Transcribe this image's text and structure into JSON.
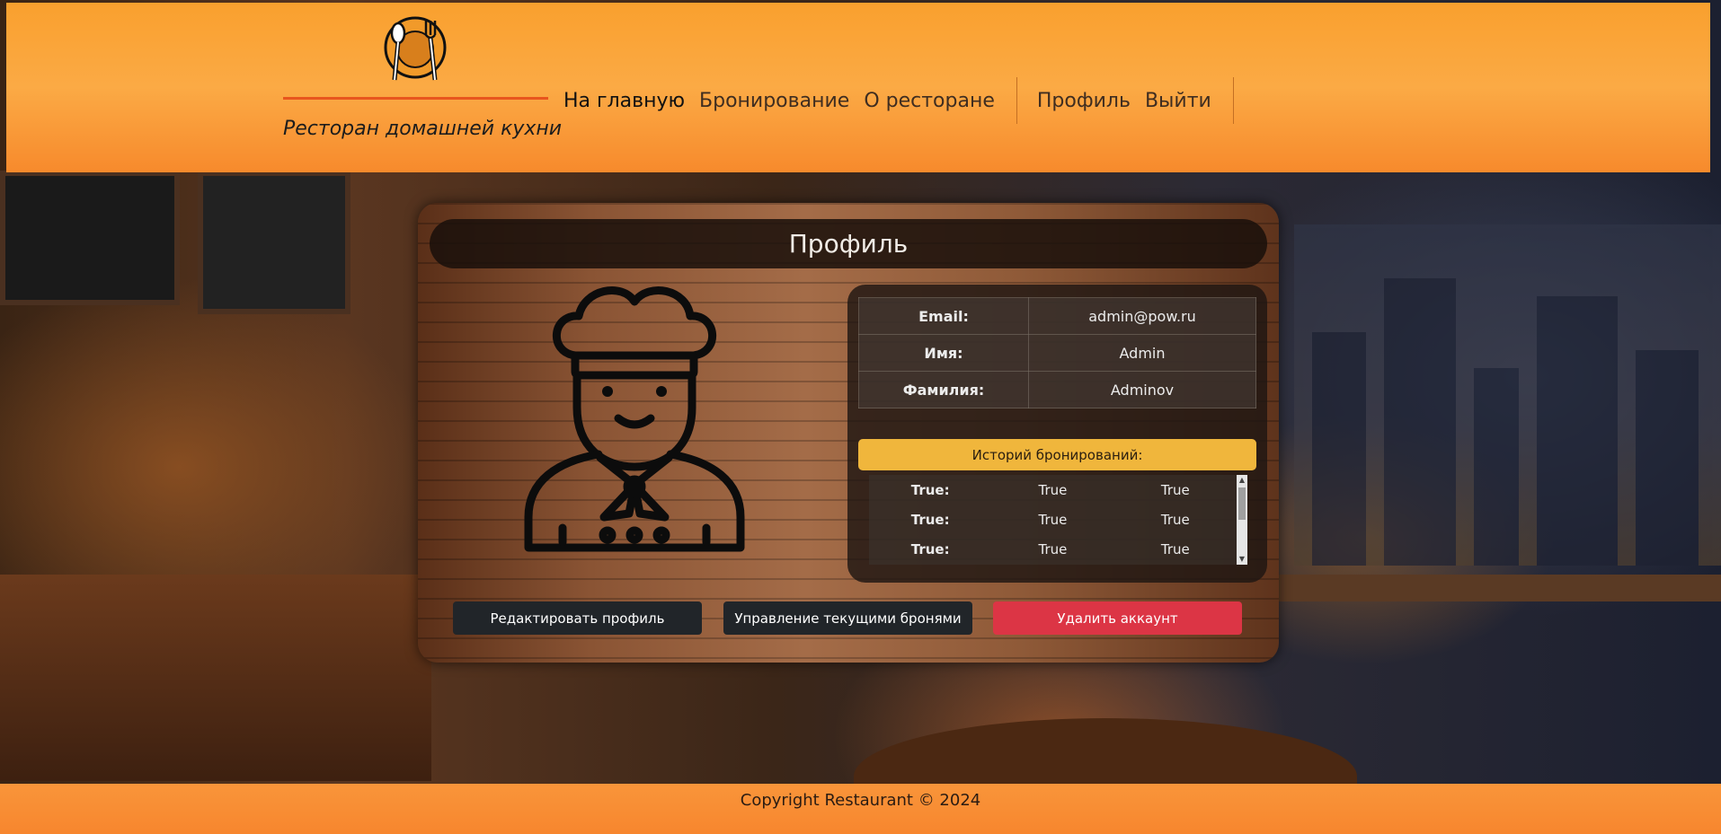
{
  "header": {
    "logo": "restaurant-plate-fork-spoon-logo",
    "tagline": "Ресторан домашней кухни",
    "nav": {
      "home": "На главную",
      "booking": "Бронирование",
      "about": "О ресторане",
      "profile": "Профиль",
      "logout": "Выйти"
    }
  },
  "profile": {
    "title": "Профиль",
    "avatar": "chef-icon",
    "info": {
      "email_label": "Email:",
      "email_value": "admin@pow.ru",
      "name_label": "Имя:",
      "name_value": "Admin",
      "surname_label": "Фамилия:",
      "surname_value": "Adminov"
    },
    "history": {
      "title": "Историй бронирований:",
      "rows": [
        [
          "True:",
          "True",
          "True"
        ],
        [
          "True:",
          "True",
          "True"
        ],
        [
          "True:",
          "True",
          "True"
        ]
      ]
    },
    "buttons": {
      "edit": "Редактировать профиль",
      "manage": "Управление текущими бронями",
      "delete": "Удалить аккаунт"
    }
  },
  "footer": {
    "copyright": "Copyright Restaurant © 2024"
  },
  "colors": {
    "header": "#fbaa45",
    "accent_yellow": "#f0b63c",
    "danger": "#dc3545",
    "dark_button": "#212529"
  }
}
